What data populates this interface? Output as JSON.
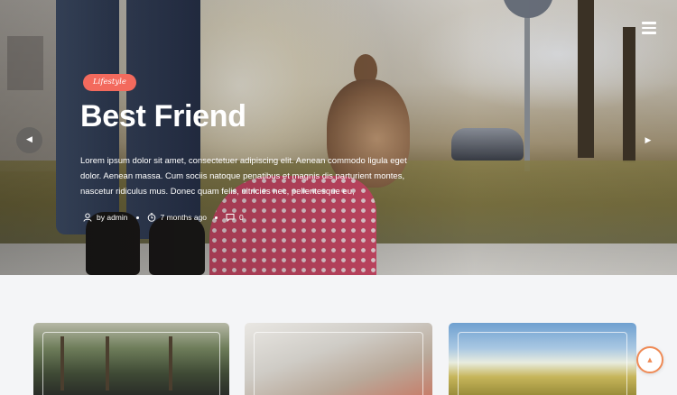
{
  "hero": {
    "category": "Lifestyle",
    "title": "Best Friend",
    "excerpt": "Lorem ipsum dolor sit amet, consectetuer adipiscing elit. Aenean commodo ligula eget dolor. Aenean massa. Cum sociis natoque penatibus et magnis dis parturient montes, nascetur ridiculus mus. Donec quam felis, ultricies nec, pellentesque eu,",
    "author": "by admin",
    "time": "7 months ago",
    "comments": "0"
  },
  "controls": {
    "prev_glyph": "◀",
    "next_glyph": "▶",
    "scroll_top_glyph": "▲"
  },
  "icons": {
    "menu": "hamburger-menu-icon",
    "user": "user-icon",
    "clock": "clock-icon",
    "comment": "comment-icon"
  },
  "colors": {
    "accent": "#f36a5d",
    "scroll_top": "#ef8a55"
  }
}
